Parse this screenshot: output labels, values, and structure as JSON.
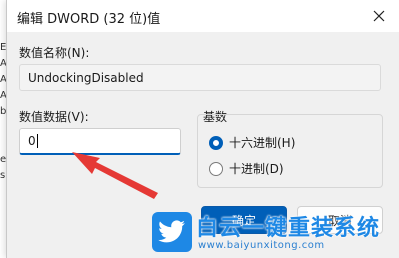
{
  "background_window": {
    "fragments": [
      "Ev",
      "Au",
      "Ac",
      "A",
      "b",
      "es",
      "s"
    ]
  },
  "dialog": {
    "title": "编辑 DWORD (32 位)值",
    "value_name_label": "数值名称(N):",
    "value_name": "UndockingDisabled",
    "value_data_label": "数值数据(V):",
    "value_data": "0",
    "base_group_label": "基数",
    "base_options": [
      {
        "label": "十六进制(H)",
        "selected": true
      },
      {
        "label": "十进制(D)",
        "selected": false
      }
    ],
    "ok_label": "确定",
    "cancel_label": "取消"
  },
  "watermark": {
    "title": "白云一键重装系统",
    "url": "www.baiyunxitong.com"
  },
  "colors": {
    "accent": "#005fb8",
    "arrow": "#e53935",
    "watermark": "#1e88e5"
  }
}
